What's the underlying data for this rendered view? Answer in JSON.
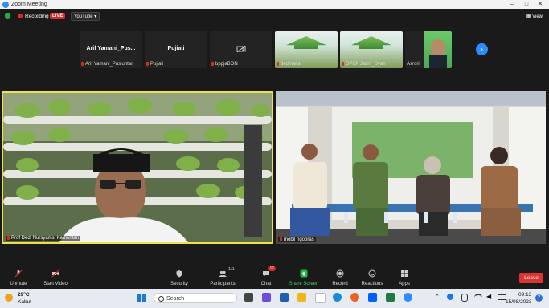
{
  "window": {
    "title": "Zoom Meeting",
    "minimize": "–",
    "maximize": "□",
    "close": "✕"
  },
  "topbar": {
    "recording": "Recording",
    "live": "LIVE",
    "youtube": "YouTube ▾",
    "view": "View"
  },
  "participants_strip": [
    {
      "display": "Arif Yamani_Pus...",
      "name": "Arif Yamani_Pusluhtan",
      "muted": true
    },
    {
      "display": "Pujiati",
      "name": "Pujiati",
      "muted": true
    },
    {
      "display": "",
      "name": "bppjaBON",
      "muted": true,
      "video_off": true
    },
    {
      "display": "",
      "name": "dedmalta",
      "muted": false
    },
    {
      "display": "",
      "name": "DPKP Jatim_Dyah",
      "muted": false
    },
    {
      "display": "",
      "name": "Asrori",
      "muted": false
    }
  ],
  "main_videos": [
    {
      "name": "Prof Dedi Nursyamsi Kementan"
    },
    {
      "name": "mobil ngobras"
    }
  ],
  "controls": [
    {
      "label": "Unmute",
      "icon": "mic-off-icon"
    },
    {
      "label": "Start Video",
      "icon": "video-off-icon"
    },
    {
      "label": "Security",
      "icon": "shield-icon"
    },
    {
      "label": "Participants",
      "icon": "people-icon",
      "badge": "111"
    },
    {
      "label": "Chat",
      "icon": "chat-icon",
      "badge": "17"
    },
    {
      "label": "Share Screen",
      "icon": "share-screen-icon"
    },
    {
      "label": "Record",
      "icon": "record-icon"
    },
    {
      "label": "Reactions",
      "icon": "smile-icon"
    },
    {
      "label": "Apps",
      "icon": "apps-icon"
    }
  ],
  "leave": "Leave",
  "taskbar": {
    "temp": "29°C",
    "weather": "Kabut",
    "search": "Search",
    "time": "09:13",
    "date": "15/08/2023",
    "notif": "2"
  },
  "colors": {
    "accent": "#2d8cff",
    "live": "#e02828",
    "leave": "#d33333",
    "active_speaker": "#f0e04a"
  }
}
